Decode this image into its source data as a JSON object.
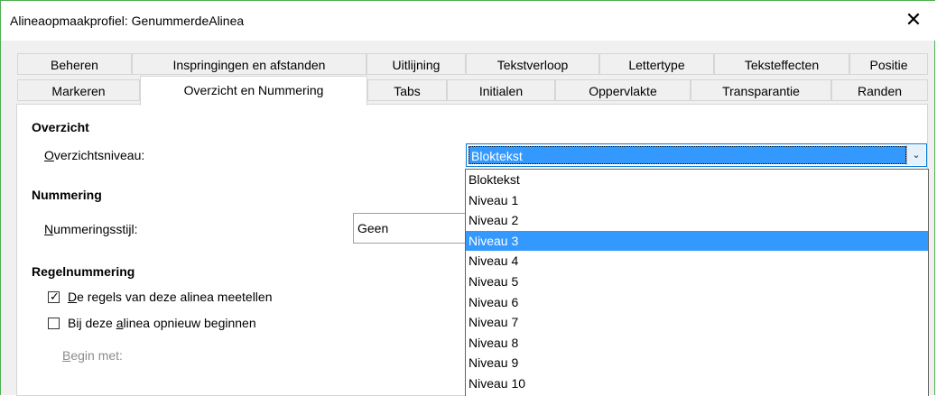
{
  "window": {
    "title": "Alineaopmaakprofiel: GenummerdeAlinea",
    "close_glyph": "✕"
  },
  "tabs_row1": [
    "Beheren",
    "Inspringingen en afstanden",
    "Uitlijning",
    "Tekstverloop",
    "Lettertype",
    "Teksteffecten",
    "Positie"
  ],
  "tabs_row2": [
    "Markeren",
    "Overzicht en Nummering",
    "Tabs",
    "Initialen",
    "Oppervlakte",
    "Transparantie",
    "Randen"
  ],
  "active_tab": "Overzicht en Nummering",
  "overzicht": {
    "heading": "Overzicht",
    "level_label_u": "O",
    "level_label_rest": "verzichtsniveau:",
    "level_value": "Bloktekst"
  },
  "nummering": {
    "heading": "Nummering",
    "style_label_u": "N",
    "style_label_rest": "ummeringsstijl:",
    "style_value": "Geen"
  },
  "regelnummering": {
    "heading": "Regelnummering",
    "count_label_u": "D",
    "count_label_rest": "e regels van deze alinea meetellen",
    "count_checked": true,
    "restart_label_pre": "Bij deze ",
    "restart_label_u": "a",
    "restart_label_rest": "linea opnieuw beginnen",
    "restart_checked": false,
    "begin_label_u": "B",
    "begin_label_rest": "egin met:"
  },
  "dropdown": {
    "options": [
      "Bloktekst",
      "Niveau 1",
      "Niveau 2",
      "Niveau 3",
      "Niveau 4",
      "Niveau 5",
      "Niveau 6",
      "Niveau 7",
      "Niveau 8",
      "Niveau 9",
      "Niveau 10"
    ],
    "highlighted": "Niveau 3"
  }
}
